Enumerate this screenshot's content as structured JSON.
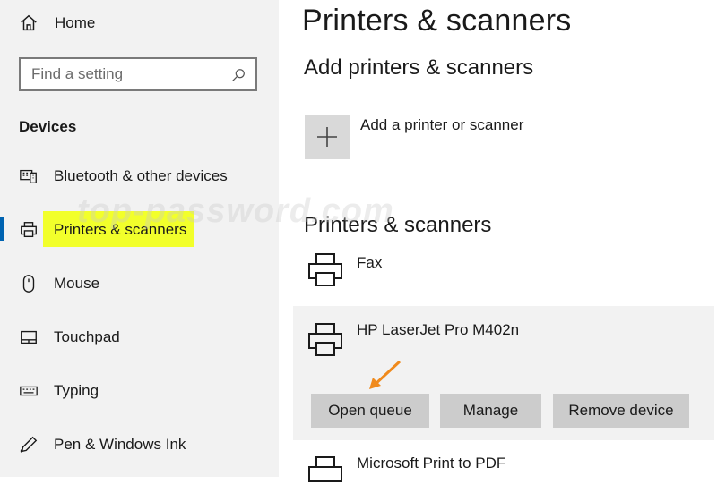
{
  "sidebar": {
    "home_label": "Home",
    "search_placeholder": "Find a setting",
    "section_heading": "Devices",
    "items": [
      {
        "label": "Bluetooth & other devices",
        "icon": "bluetooth-devices-icon"
      },
      {
        "label": "Printers & scanners",
        "icon": "printer-icon",
        "selected": true
      },
      {
        "label": "Mouse",
        "icon": "mouse-icon"
      },
      {
        "label": "Touchpad",
        "icon": "touchpad-icon"
      },
      {
        "label": "Typing",
        "icon": "keyboard-icon"
      },
      {
        "label": "Pen & Windows Ink",
        "icon": "pen-icon"
      }
    ]
  },
  "main": {
    "page_title": "Printers & scanners",
    "add_section_heading": "Add printers & scanners",
    "add_label": "Add a printer or scanner",
    "list_heading": "Printers & scanners",
    "devices": [
      {
        "name": "Fax"
      },
      {
        "name": "HP LaserJet Pro M402n",
        "selected": true,
        "actions": [
          "Open queue",
          "Manage",
          "Remove device"
        ]
      },
      {
        "name": "Microsoft Print to PDF"
      }
    ]
  },
  "watermark": "top-password.com",
  "colors": {
    "sidebar_bg": "#f2f2f2",
    "accent": "#0063b1",
    "highlight": "#f2ff2b",
    "button_bg": "#cccccc",
    "arrow": "#f08a1c"
  }
}
